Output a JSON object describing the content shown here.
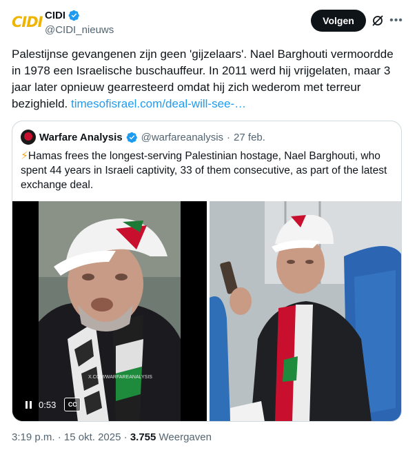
{
  "author": {
    "logo_text": "CIDI",
    "display_name": "CIDI",
    "handle": "@CIDI_nieuws"
  },
  "follow_label": "Volgen",
  "tweet": {
    "text": "Palestijnse gevangenen zijn geen 'gijzelaars'. Nael Barghouti vermoordde in 1978 een Israelische buschauffeur. In 2011 werd hij vrijgelaten, maar 3 jaar later opnieuw gearresteerd omdat hij zich wederom met terreur bezighield.",
    "link_text": "timesofisrael.com/deal-will-see-…"
  },
  "quote": {
    "display_name": "Warfare Analysis",
    "handle": "@warfareanalysis",
    "separator": "·",
    "date": "27 feb.",
    "emoji": "⚡",
    "text": "Hamas frees the longest-serving Palestinian hostage, Nael Barghouti, who spent 44 years in Israeli captivity, 33 of them consecutive, as part of the latest exchange deal.",
    "video": {
      "time": "0:53",
      "cc_label": "CC",
      "watermark": "X.COM/WARFAREANALYSIS"
    }
  },
  "footer": {
    "time": "3:19 p.m.",
    "sep1": " · ",
    "date": "15 okt. 2025",
    "sep2": " · ",
    "views": "3.755",
    "views_label": " Weergaven"
  },
  "colors": {
    "link": "#1d9bf0",
    "verified": "#1d9bf0",
    "logo": "#f0b400",
    "follow_bg": "#0f1419"
  },
  "icons": [
    "verified-badge-icon",
    "grok-icon",
    "more-icon",
    "pause-icon",
    "captions-icon",
    "lightning-icon"
  ]
}
